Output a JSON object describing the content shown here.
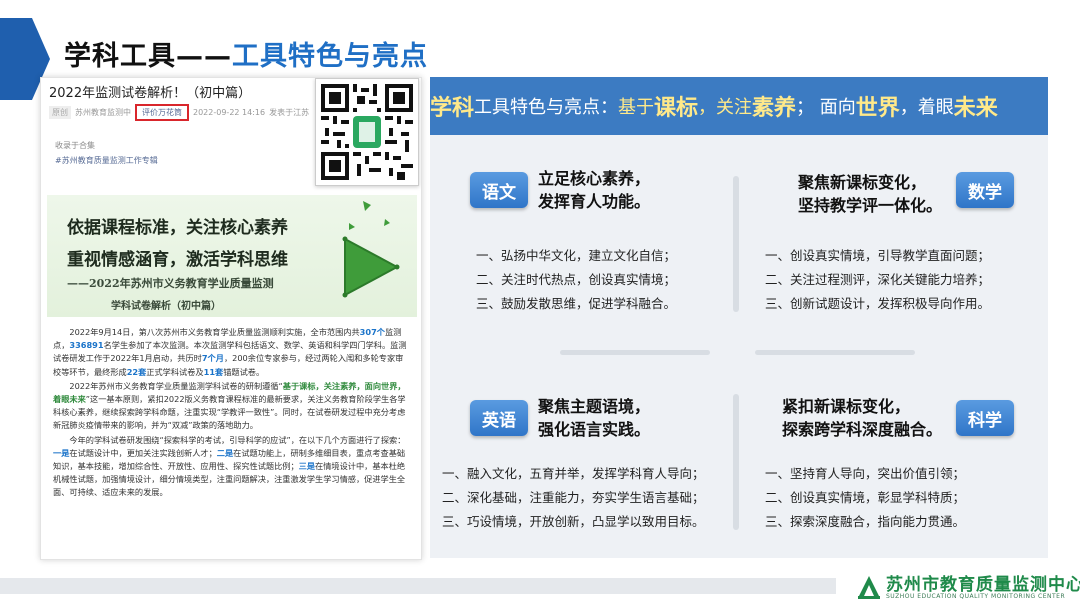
{
  "page": {
    "title_part1": "学科工具——",
    "title_part2": "工具特色与亮点"
  },
  "article": {
    "title": "2022年监测试卷解析！（初中篇）",
    "meta_tag": "原创",
    "meta_source": "苏州教育监测中",
    "meta_boxed": "评价万花筒",
    "meta_date": "2022-09-22 14:16",
    "meta_location": "发表于江苏",
    "collect_label": "收录于合集",
    "hashtag": "#苏州教育质量监测工作专辑",
    "banner_line1": "依据课程标准，关注核心素养",
    "banner_line2": "重视情感涵育，激活学科思维",
    "banner_line3": "——2022年苏州市义务教育学业质量监测",
    "banner_line4": "学科试卷解析（初中篇）",
    "p1_a": "2022年9月14日，第八次苏州市义务教育学业质量监测顺利实施，全市范围内共",
    "p1_b": "307个",
    "p1_c": "监测点，",
    "p1_d": "336891",
    "p1_e": "名学生参加了本次监测。本次监测学科包括语文、数学、英语和科学四门学科。监测试卷研发工作于2022年1月启动，共历时",
    "p1_f": "7个月",
    "p1_g": "，200余位专家参与，经过两轮入闱和多轮专家审校等环节，最终形成",
    "p1_h": "22套",
    "p1_i": "正式学科试卷及",
    "p1_j": "11套",
    "p1_k": "锚题试卷。",
    "p2_a": "2022年苏州市义务教育学业质量监测学科试卷的研制遵循“",
    "p2_b": "基于课标，关注素养，面向世界，着眼未来",
    "p2_c": "”这一基本原则，紧扣2022版义务教育课程标准的最新要求，关注义务教育阶段学生各学科核心素养，继续探索跨学科命题，注重实现“学教评一致性”。同时，在试卷研发过程中充分考虑新冠肺炎疫情带来的影响，并为“双减”政策的落地助力。",
    "p3_a": "今年的学科试卷研发围绕“探索科学的考试，引导科学的应试”，在以下几个方面进行了探索：",
    "p3_b": "一是",
    "p3_c": "在试题设计中，更加关注实践创新人才；",
    "p3_d": "二是",
    "p3_e": "在试题功能上，研制多维细目表，重点考查基础知识，基本技能，增加综合性、开放性、应用性、探究性试题比例；",
    "p3_f": "三是",
    "p3_g": "在情境设计中，基本杜绝机械性试题，加强情境设计，细分情境类型，注重问题解决，注重激发学生学习情感，促进学生全面、可持续、适应未来的发展。"
  },
  "panel": {
    "header_h1": "学科",
    "header_h2": "工具特色与亮点：",
    "header_h3": "基于",
    "header_h4": "课标",
    "header_h5": "，关注",
    "header_h6": "素养",
    "header_h7": "； 面向",
    "header_h8": "世界",
    "header_h9": "，着眼",
    "header_h10": "未来",
    "chinese": {
      "badge": "语文",
      "head1": "立足核心素养，",
      "head2": "发挥育人功能。",
      "items": [
        "一、弘扬中华文化，建立文化自信；",
        "二、关注时代热点，创设真实情境；",
        "三、鼓励发散思维，促进学科融合。"
      ]
    },
    "math": {
      "badge": "数学",
      "head1": "聚焦新课标变化，",
      "head2": "坚持教学评一体化。",
      "items": [
        "一、创设真实情境，引导教学直面问题；",
        "二、关注过程测评，深化关键能力培养；",
        "三、创新试题设计，发挥积极导向作用。"
      ]
    },
    "english": {
      "badge": "英语",
      "head1": "聚焦主题语境，",
      "head2": "强化语言实践。",
      "items": [
        "一、融入文化，五育并举，发挥学科育人导向；",
        "二、深化基础，注重能力，夯实学生语言基础；",
        "三、巧设情境，开放创新，凸显学以致用目标。"
      ]
    },
    "science": {
      "badge": "科学",
      "head1": "紧扣新课标变化，",
      "head2": "探索跨学科深度融合。",
      "items": [
        "一、坚持育人导向，突出价值引领；",
        "二、创设真实情境，彰显学科特质；",
        "三、探索深度融合，指向能力贯通。"
      ]
    }
  },
  "footer": {
    "org_name": "苏州市教育质量监测中心",
    "org_en": "SUZHOU EDUCATION QUALITY MONITORING CENTER"
  },
  "colors": {
    "accent_blue": "#3c7bc2",
    "title_blue": "#1f6fc5",
    "highlight_yellow": "#ffe98a",
    "logo_green": "#1f8a4a"
  }
}
